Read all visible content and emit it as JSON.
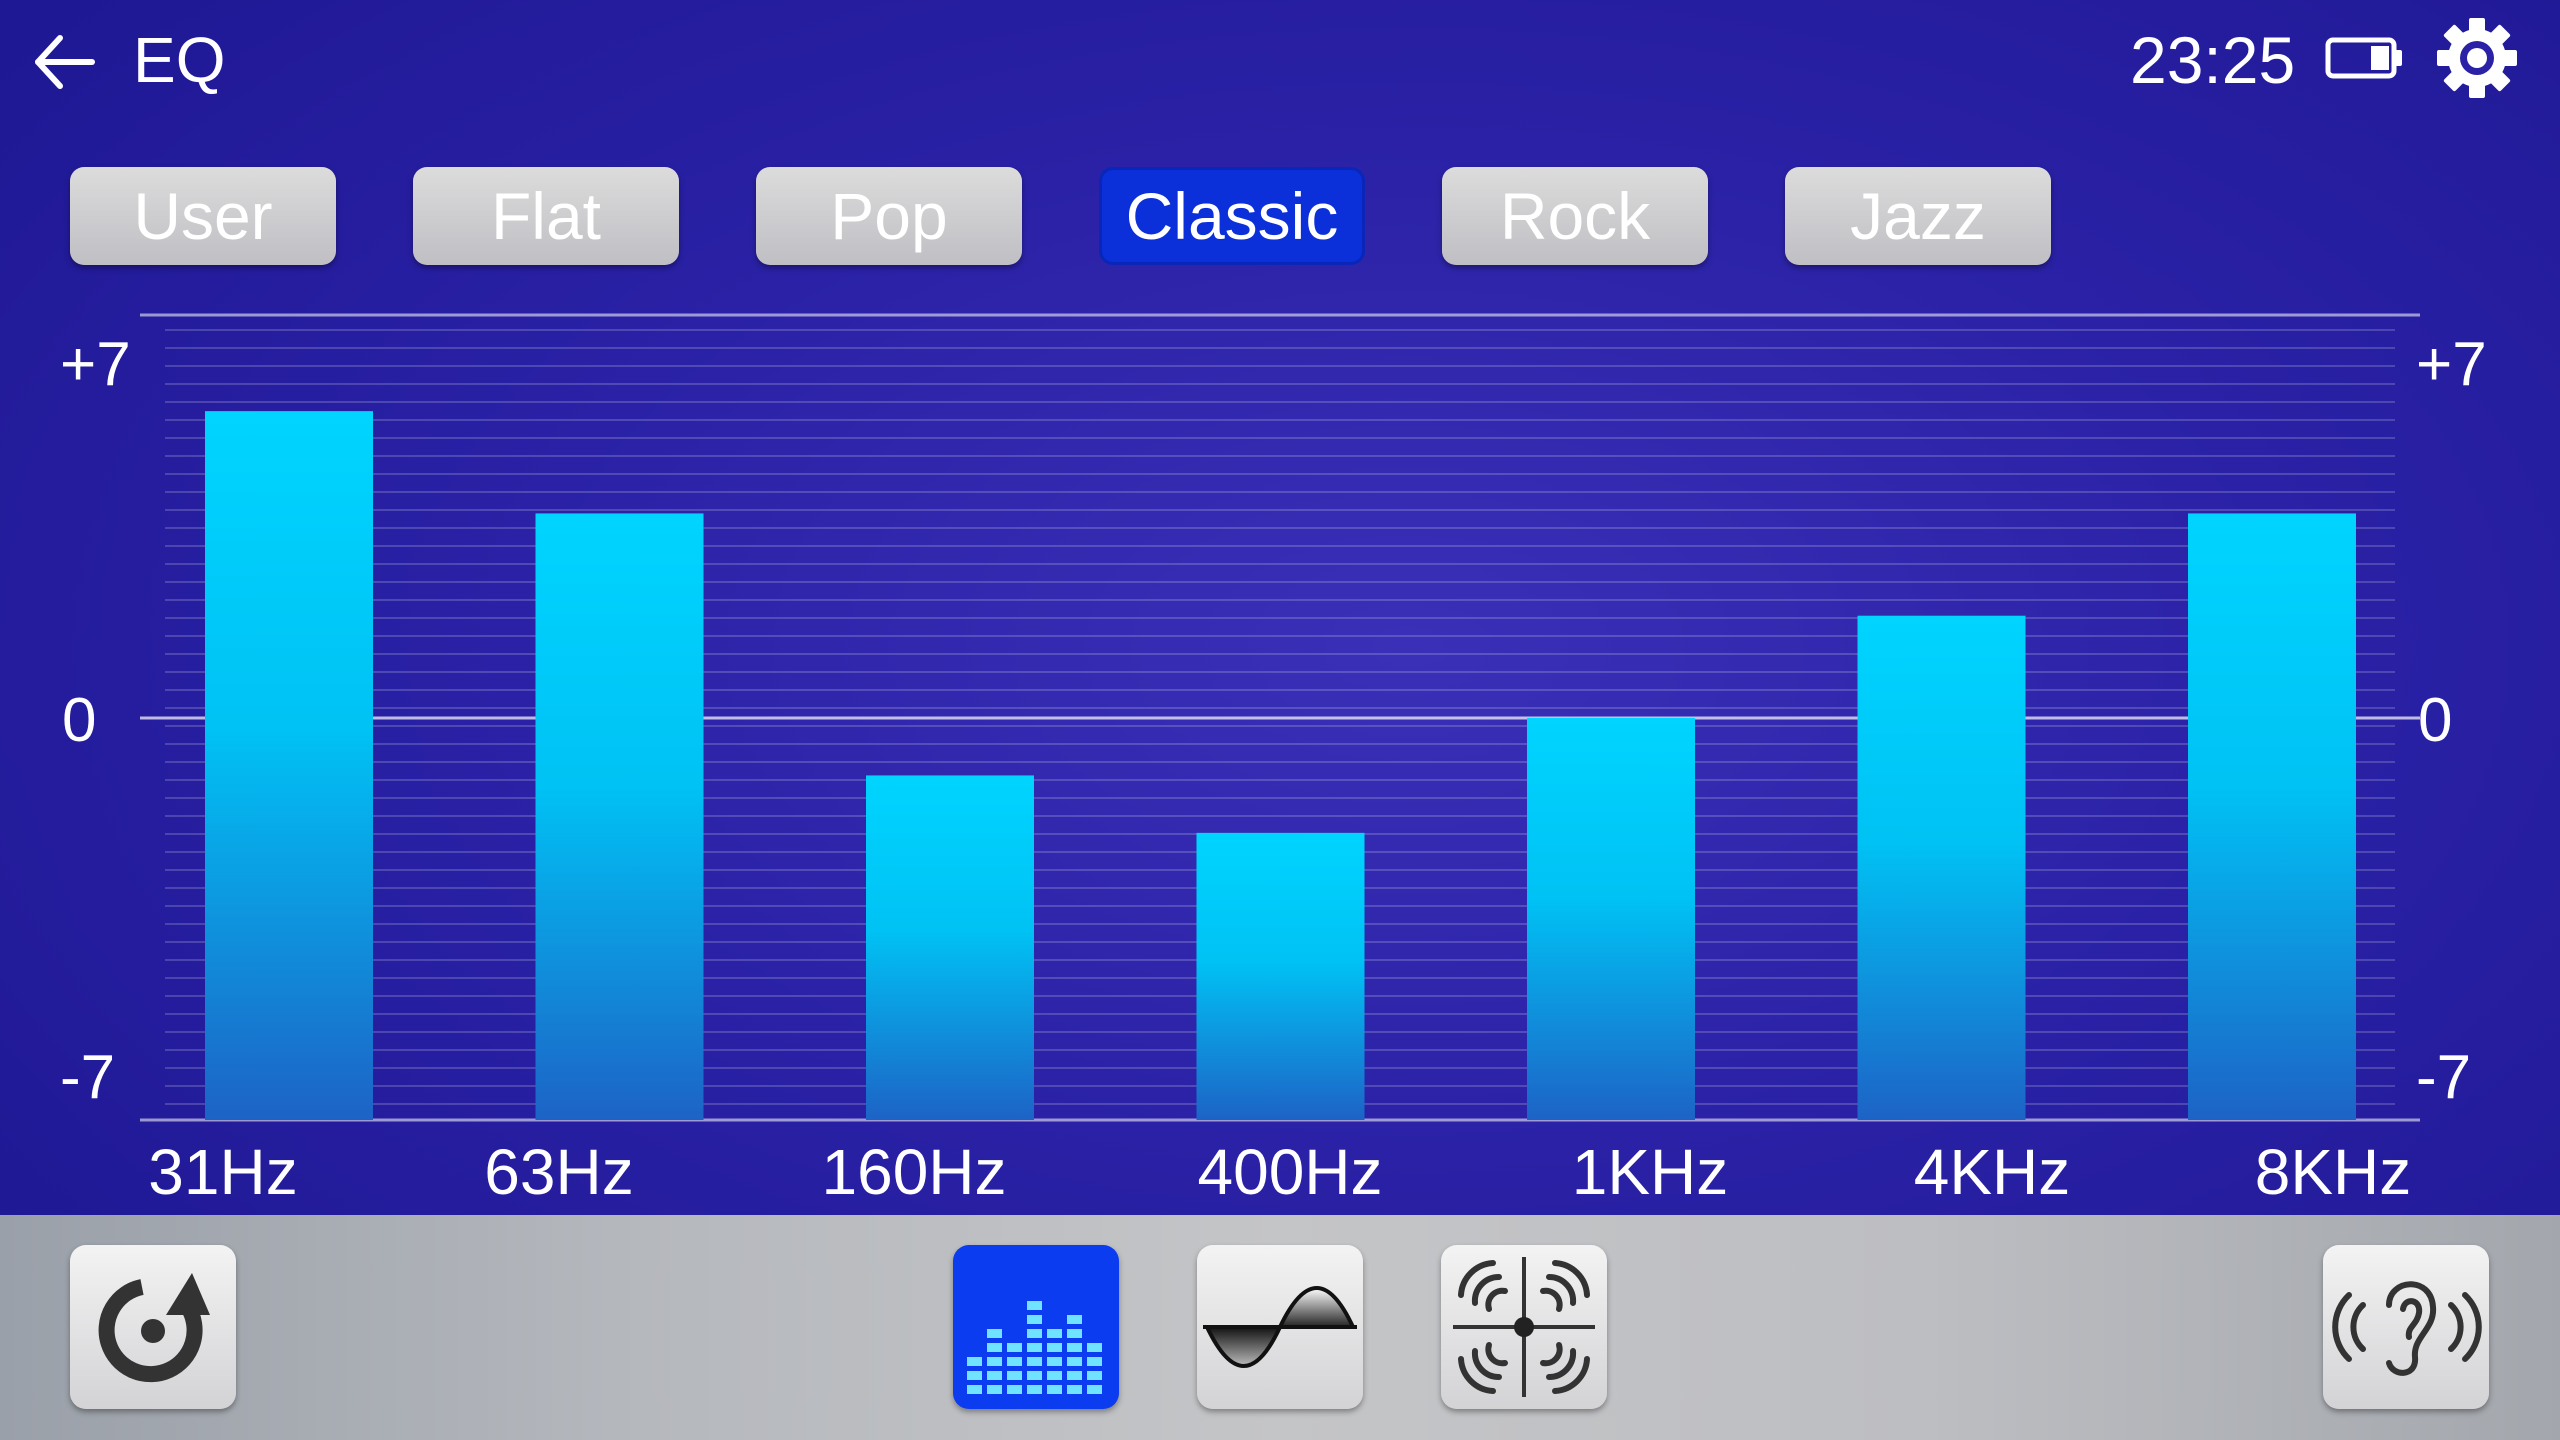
{
  "header": {
    "title": "EQ",
    "time": "23:25",
    "icons": {
      "back": "back-arrow-icon",
      "battery": "battery-icon",
      "settings": "gear-icon"
    }
  },
  "presets": [
    {
      "label": "User",
      "active": false
    },
    {
      "label": "Flat",
      "active": false
    },
    {
      "label": "Pop",
      "active": false
    },
    {
      "label": "Classic",
      "active": true
    },
    {
      "label": "Rock",
      "active": false
    },
    {
      "label": "Jazz",
      "active": false
    }
  ],
  "chart_data": {
    "type": "bar",
    "categories": [
      "31Hz",
      "63Hz",
      "160Hz",
      "400Hz",
      "1KHz",
      "4KHz",
      "8KHz"
    ],
    "values": [
      6,
      4,
      -1,
      -2,
      0,
      2,
      4
    ],
    "ylim": [
      -7,
      7
    ],
    "y_ticks": [
      "+7",
      "0",
      "-7"
    ],
    "grid": true,
    "bar_color": "#00ccff"
  },
  "toolbar": {
    "items": [
      {
        "name": "reset",
        "icon": "reset-rotate-icon",
        "active": false
      },
      {
        "name": "equalizer",
        "icon": "equalizer-bars-icon",
        "active": true
      },
      {
        "name": "bass-curve",
        "icon": "sine-wave-icon",
        "active": false
      },
      {
        "name": "sound-field",
        "icon": "sound-field-balance-icon",
        "active": false
      },
      {
        "name": "loudness",
        "icon": "ear-sound-icon",
        "active": false
      }
    ]
  },
  "colors": {
    "background": "#2a21a6",
    "accent": "#0b2fd9",
    "bar": "#00ccff"
  }
}
